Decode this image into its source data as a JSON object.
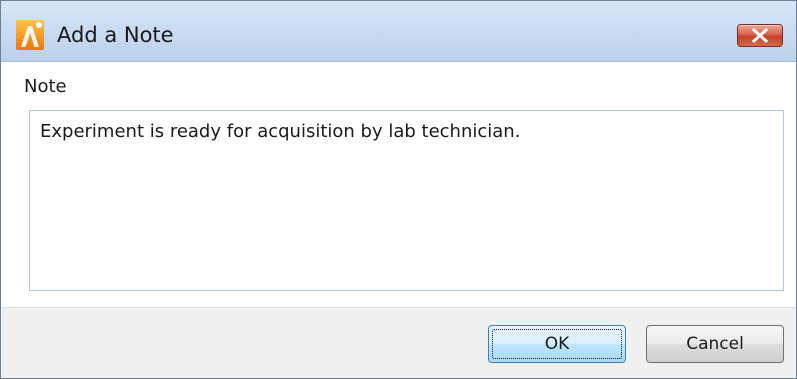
{
  "window": {
    "title": "Add a Note",
    "icon": "app-logo-icon",
    "close_icon": "close-icon"
  },
  "note": {
    "label": "Note",
    "value": "Experiment is ready for acquisition by lab technician."
  },
  "buttons": {
    "ok": "OK",
    "cancel": "Cancel"
  },
  "colors": {
    "titlebar": "#c9dcf2",
    "close_button": "#d9634b",
    "app_icon": "#f59a1b",
    "focused_button_border": "#3c7fb1",
    "footer": "#f0f0f0"
  }
}
